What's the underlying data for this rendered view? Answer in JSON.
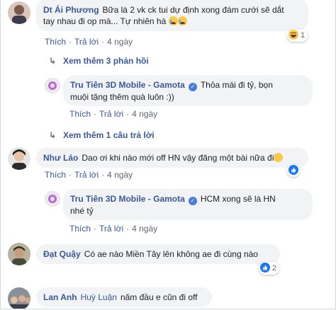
{
  "comments": [
    {
      "author": "Dt Ái Phương",
      "text_line1": "Bữa là 2 vk ck tui dự định xong đám cưới sẽ dắt",
      "text_line2": "tay nhau đi op mà... Tự nhiên hà",
      "reaction_count": "1",
      "like": "Thích",
      "reply": "Trả lời",
      "time": "4 ngày",
      "more_replies": "Xem thêm 3 phản hồi"
    },
    {
      "author": "Tru Tiên 3D Mobile - Gamota",
      "text_line1": "Thỏa mái đi tỷ, bọn",
      "text_line2": "muội tặng thêm quà luôn :))",
      "like": "Thích",
      "reply": "Trả lời",
      "time": "4 ngày"
    },
    {
      "more_replies": "Xem thêm 1 câu trả lời"
    },
    {
      "author": "Như Láo",
      "text_line1": "Dao ơi khi nào mới off HN vậy đăng một bài nữa đi",
      "like": "Thích",
      "reply": "Trả lời",
      "time": "4 ngày"
    },
    {
      "author": "Tru Tiên 3D Mobile - Gamota",
      "text_line1": "HCM xong sẽ là HN",
      "text_line2": "nhé tỷ",
      "like": "Thích",
      "reply": "Trả lời",
      "time": "4 ngày"
    },
    {
      "author": "Đạt Quậy",
      "text_line1": "Có ae nào Miền Tây lên không ae đi cùng nào",
      "reaction_count": "2"
    },
    {
      "author": "Lan Anh",
      "tag": "Huỳ Luận",
      "text_line1": "năm đầu e cũn đi off"
    }
  ],
  "colors": {
    "link": "#385898",
    "bubble": "#f2f3f5",
    "like": "#1877f2"
  }
}
